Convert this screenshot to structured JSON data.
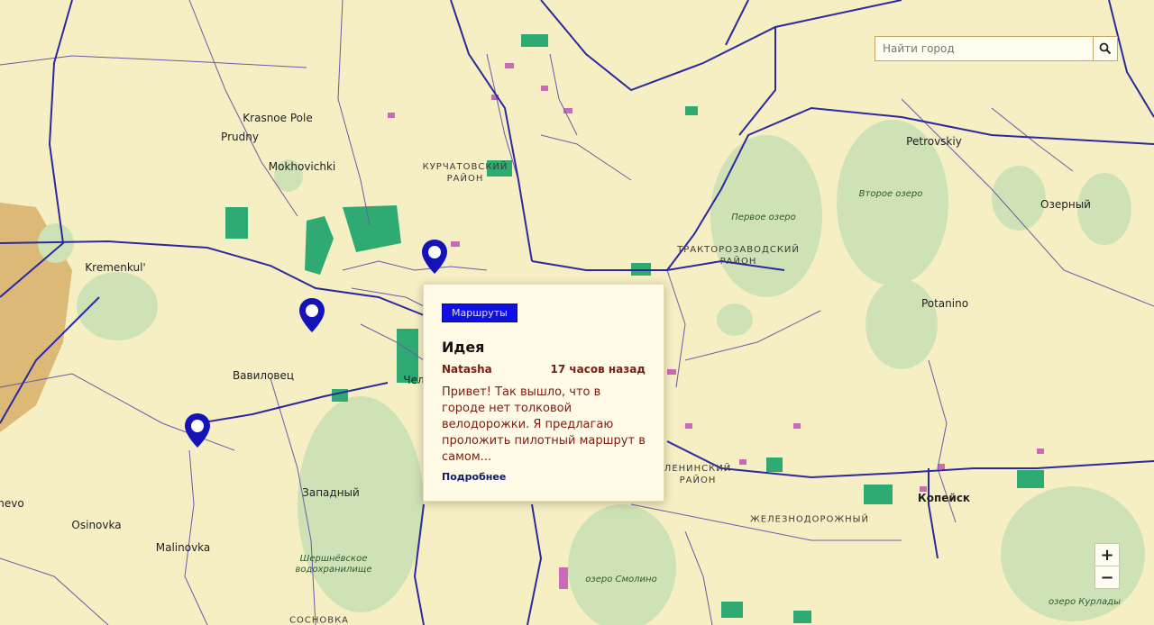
{
  "search": {
    "placeholder": "Найти город"
  },
  "zoom": {
    "in_label": "+",
    "out_label": "−"
  },
  "places": [
    {
      "name": "Krasnoe Pole"
    },
    {
      "name": "Prudny"
    },
    {
      "name": "Mokhovichki"
    },
    {
      "name": "Kremenkul'"
    },
    {
      "name": "Вавиловец"
    },
    {
      "name": "Западный"
    },
    {
      "name": "Osinovka"
    },
    {
      "name": "Malinovka"
    },
    {
      "name": "hevo"
    },
    {
      "name": "Petrovskiy"
    },
    {
      "name": "Озерный"
    },
    {
      "name": "Potanino"
    },
    {
      "name": "Копейск"
    },
    {
      "name": "Чел"
    }
  ],
  "districts": [
    {
      "line1": "КУРЧАТОВСКИЙ",
      "line2": "РАЙОН"
    },
    {
      "line1": "ТРАКТОРОЗАВОДСКИЙ",
      "line2": "РАЙОН"
    },
    {
      "line1": "ЛЕНИНСКИЙ",
      "line2": "РАЙОН"
    },
    {
      "line1": "ЖЕЛЕЗНОДОРОЖНЫЙ",
      "line2": ""
    },
    {
      "line1": "СОСНОВКА",
      "line2": ""
    }
  ],
  "water": [
    {
      "line1": "Первое озеро",
      "line2": ""
    },
    {
      "line1": "Второе озеро",
      "line2": ""
    },
    {
      "line1": "Шершнёвское",
      "line2": "водохранилище"
    },
    {
      "line1": "озеро Смолино",
      "line2": ""
    },
    {
      "line1": "озеро Курлады",
      "line2": ""
    }
  ],
  "popup": {
    "category": "Маршруты",
    "title": "Идея",
    "author": "Natasha",
    "time": "17 часов назад",
    "text": "Привет! Так вышло, что в городе нет толковой велодорожки. Я предлагаю проложить пилотный маршрут в самом...",
    "more_link": "Подробнее"
  },
  "colors": {
    "land": "#f6efc4",
    "water": "#cfe2b6",
    "park": "#2eaa72",
    "road_major": "#2a2a9e",
    "road_minor": "#6a5aa8",
    "pin": "#1313b8",
    "desert": "#dcb977"
  }
}
